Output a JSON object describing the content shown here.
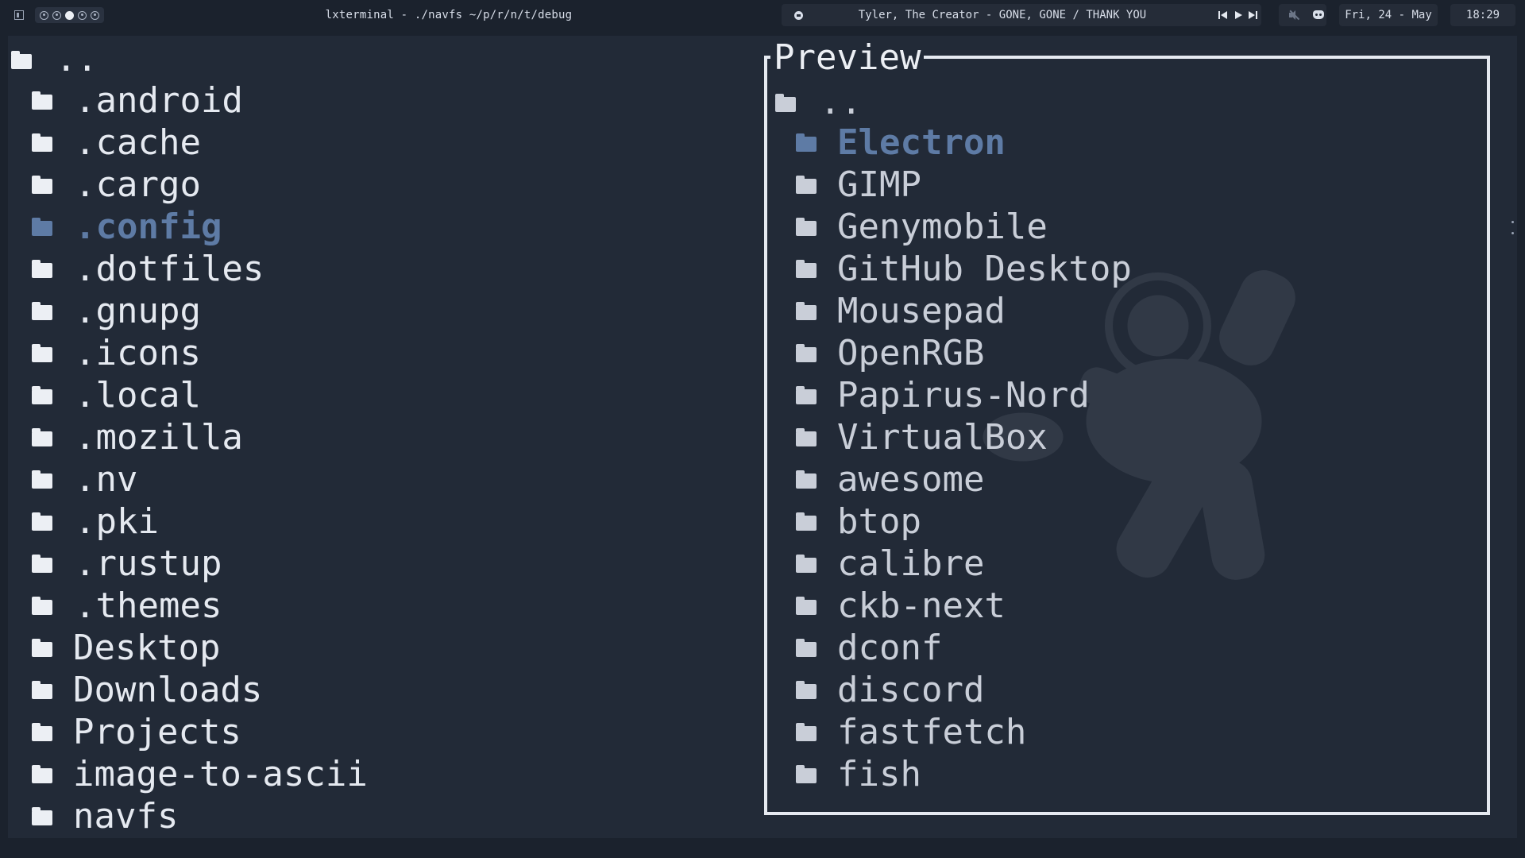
{
  "topbar": {
    "layout_icon": "layout-icon",
    "tags": [
      {
        "state": "occupied"
      },
      {
        "state": "occupied"
      },
      {
        "state": "active"
      },
      {
        "state": "occupied"
      },
      {
        "state": "occupied"
      }
    ],
    "window_title": "lxterminal - ./navfs ~/p/r/n/t/debug",
    "now_playing": "Tyler, The Creator - GONE, GONE / THANK YOU",
    "media_controls": [
      "previous",
      "play",
      "next"
    ],
    "tray_icons": [
      "muted-speaker-icon",
      "discord-icon"
    ],
    "date": "Fri, 24 - May",
    "time": "18:29"
  },
  "file_list": {
    "parent": "..",
    "items": [
      {
        "name": ".android"
      },
      {
        "name": ".cache"
      },
      {
        "name": ".cargo"
      },
      {
        "name": ".config",
        "selected": true
      },
      {
        "name": ".dotfiles"
      },
      {
        "name": ".gnupg"
      },
      {
        "name": ".icons"
      },
      {
        "name": ".local"
      },
      {
        "name": ".mozilla"
      },
      {
        "name": ".nv"
      },
      {
        "name": ".pki"
      },
      {
        "name": ".rustup"
      },
      {
        "name": ".themes"
      },
      {
        "name": "Desktop"
      },
      {
        "name": "Downloads"
      },
      {
        "name": "Projects"
      },
      {
        "name": "image-to-ascii"
      },
      {
        "name": "navfs"
      }
    ]
  },
  "preview": {
    "title": "Preview",
    "parent": "..",
    "items": [
      {
        "name": "Electron",
        "selected": true
      },
      {
        "name": "GIMP"
      },
      {
        "name": "Genymobile"
      },
      {
        "name": "GitHub Desktop"
      },
      {
        "name": "Mousepad"
      },
      {
        "name": "OpenRGB"
      },
      {
        "name": "Papirus-Nord"
      },
      {
        "name": "VirtualBox"
      },
      {
        "name": "awesome"
      },
      {
        "name": "btop"
      },
      {
        "name": "calibre"
      },
      {
        "name": "ckb-next"
      },
      {
        "name": "dconf"
      },
      {
        "name": "discord"
      },
      {
        "name": "fastfetch"
      },
      {
        "name": "fish"
      }
    ]
  },
  "colors": {
    "background": "#1b222d",
    "terminal_bg": "#222a37",
    "text": "#e5e9f0",
    "selected": "#5e7ba5",
    "preview_border": "#e5e9f0"
  }
}
